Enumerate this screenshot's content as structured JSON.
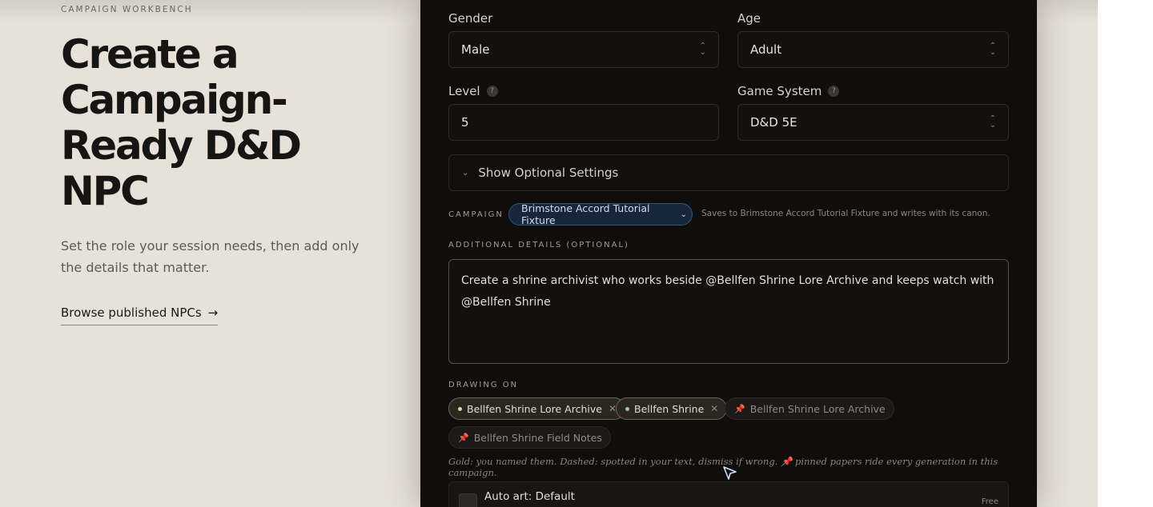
{
  "hero": {
    "eyebrow": "CAMPAIGN WORKBENCH",
    "title": "Create a Campaign-Ready D&D NPC",
    "subtitle": "Set the role your session needs, then add only the details that matter.",
    "browse_link": "Browse published NPCs",
    "browse_icon": "arrow-right-icon"
  },
  "form": {
    "gender_label": "Gender",
    "gender_value": "Male",
    "age_label": "Age",
    "age_value": "Adult",
    "level_label": "Level",
    "level_value": "5",
    "game_system_label": "Game System",
    "game_system_value": "D&D 5E",
    "help_glyph": "?",
    "optional_settings_label": "Show Optional Settings",
    "campaign_label": "CAMPAIGN",
    "campaign_value": "Brimstone Accord Tutorial Fixture",
    "campaign_note": "Saves to Brimstone Accord Tutorial Fixture and writes with its canon.",
    "additional_details_label": "ADDITIONAL DETAILS (OPTIONAL)",
    "additional_details_value": "Create a shrine archivist who works beside @Bellfen Shrine Lore Archive  and keeps watch with @Bellfen Shrine",
    "drawing_on_label": "DRAWING ON",
    "chips": [
      {
        "label": "Bellfen Shrine Lore Archive",
        "style": "gold",
        "dot_color": "#e6d3a3"
      },
      {
        "label": "Bellfen Shrine",
        "style": "gold",
        "dot_color": "#7fd0c2"
      },
      {
        "label": "Bellfen Shrine Lore Archive",
        "style": "pinned"
      },
      {
        "label": "Bellfen Shrine Field Notes",
        "style": "pinned"
      }
    ],
    "legend": "Gold: you named them. Dashed: spotted in your text, dismiss if wrong. 📌 pinned papers ride every generation in this campaign.",
    "auto_art_label": "Auto art: Default",
    "auto_art_price": "Free"
  },
  "colors": {
    "page_bg": "#e7e1d9",
    "panel_bg": "#0f0e0d",
    "campaign_accent": "#35557a"
  }
}
